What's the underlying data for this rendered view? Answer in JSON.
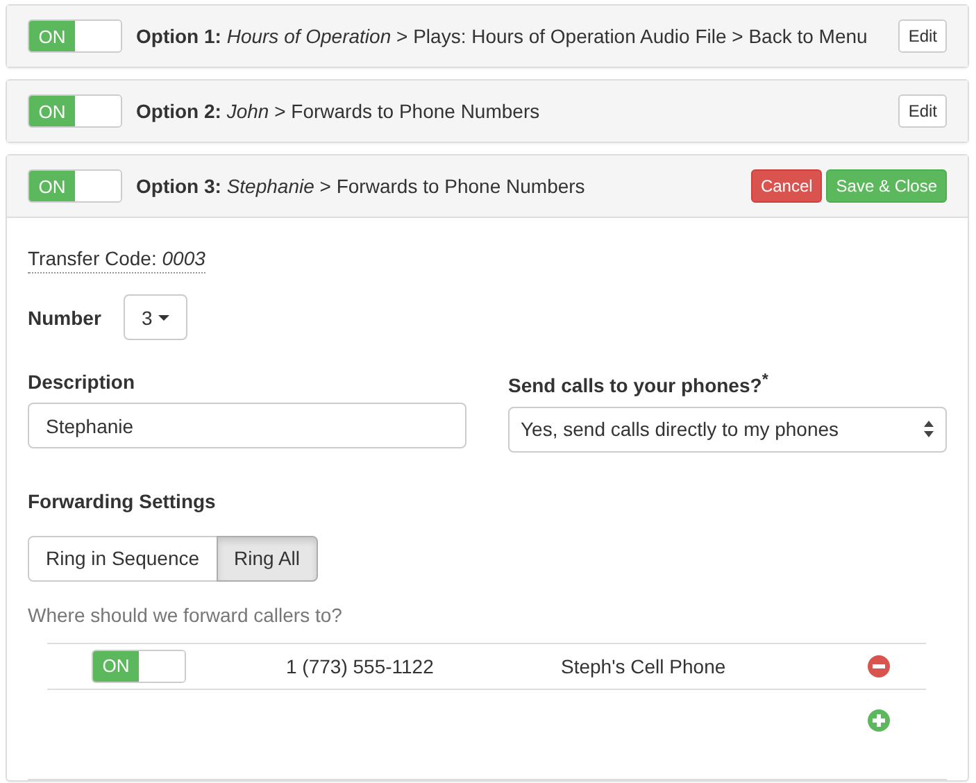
{
  "options": [
    {
      "toggle": {
        "label": "ON",
        "on": true
      },
      "title": "**Option 1:** *Hours of Operation* > Plays: Hours of Operation Audio File > Back to Menu",
      "expanded": false,
      "buttons": [
        {
          "label": "Edit",
          "kind": "default"
        }
      ]
    },
    {
      "toggle": {
        "label": "ON",
        "on": true
      },
      "title": "**Option 2:** *John* > Forwards to Phone Numbers",
      "expanded": false,
      "buttons": [
        {
          "label": "Edit",
          "kind": "default"
        }
      ]
    },
    {
      "toggle": {
        "label": "ON",
        "on": true
      },
      "title": "**Option 3:** *Stephanie* > Forwards to Phone Numbers",
      "expanded": true,
      "buttons": [
        {
          "label": "Cancel",
          "kind": "danger"
        },
        {
          "label": "Save & Close",
          "kind": "success"
        }
      ]
    }
  ],
  "editor": {
    "transfer_code": "Transfer Code: *0003*",
    "number": {
      "label": "Number",
      "value": "3"
    },
    "description": {
      "label": "Description",
      "value": "Stephanie"
    },
    "send_calls": {
      "label": "Send calls to your phones?$^{*}$",
      "value": "Yes, send calls directly to my phones"
    },
    "forwarding": {
      "heading": "Forwarding Settings",
      "modes": [
        {
          "label": "Ring in Sequence",
          "selected": false
        },
        {
          "label": "Ring All",
          "selected": true
        }
      ],
      "hint": "Where should we forward callers to?",
      "rows": [
        {
          "toggle": {
            "label": "ON",
            "on": true
          },
          "phone": "1 (773) 555-1122",
          "name": "Steph's Cell Phone"
        }
      ]
    }
  }
}
